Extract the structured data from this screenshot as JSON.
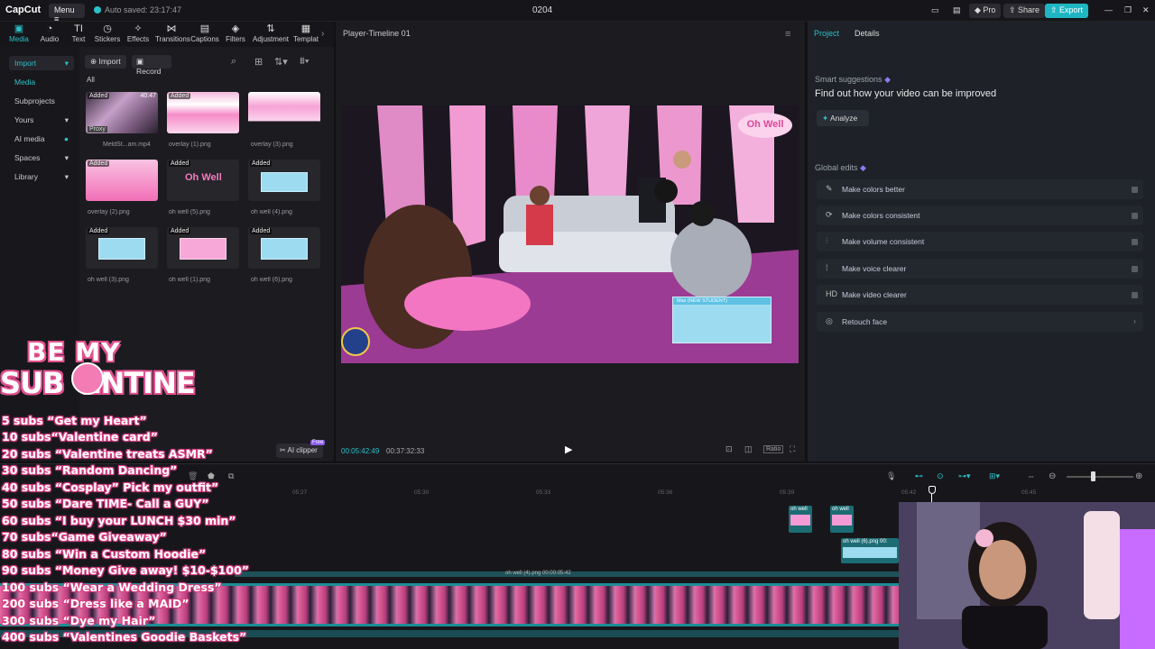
{
  "titlebar": {
    "logo": "CapCut",
    "menu": "Menu",
    "autosave": "Auto saved: 23:17:47",
    "project_name": "0204",
    "pro": "Pro",
    "share": "Share",
    "export": "Export"
  },
  "tools": [
    {
      "label": "Media",
      "icon": "▣"
    },
    {
      "label": "Audio",
      "icon": "◔"
    },
    {
      "label": "Text",
      "icon": "TI"
    },
    {
      "label": "Stickers",
      "icon": "◷"
    },
    {
      "label": "Effects",
      "icon": "✧"
    },
    {
      "label": "Transitions",
      "icon": "⋈"
    },
    {
      "label": "Captions",
      "icon": "▤"
    },
    {
      "label": "Filters",
      "icon": "◈"
    },
    {
      "label": "Adjustment",
      "icon": "⇅"
    },
    {
      "label": "Templat",
      "icon": "▦"
    }
  ],
  "sidebar": {
    "import": "Import",
    "items": [
      "Media",
      "Subprojects",
      "Yours",
      "AI media",
      "Spaces",
      "Library"
    ]
  },
  "media": {
    "import_btn": "Import",
    "record_btn": "Record",
    "filter_all": "All",
    "added_badge": "Added",
    "proxy_badge": "Proxy",
    "duration": "40:47",
    "items": [
      {
        "name": "MeldSt...am.mp4"
      },
      {
        "name": "overlay (1).png"
      },
      {
        "name": "overlay (3).png"
      },
      {
        "name": "overlay (2).png"
      },
      {
        "name": "oh well (5).png"
      },
      {
        "name": "oh well (4).png"
      },
      {
        "name": "oh well (3).png"
      },
      {
        "name": "oh well (1).png"
      },
      {
        "name": "oh well (6).png"
      }
    ],
    "ai_clipper": "AI clipper",
    "free_badge": "Free"
  },
  "player": {
    "title": "Player-Timeline 01",
    "current_time": "00:05:42:49",
    "total_time": "00:37:32:33",
    "ratio": "Ratio",
    "overlay_logo": "Oh Well",
    "popup_title": "Max (NEW STUDENT)"
  },
  "right_panel": {
    "tab_project": "Project",
    "tab_details": "Details",
    "smart_title": "Smart suggestions",
    "smart_sub": "Find out how your video can be improved",
    "analyze": "Analyze",
    "global_title": "Global edits",
    "global_items": [
      {
        "label": "Make colors better",
        "icon": "✎"
      },
      {
        "label": "Make colors consistent",
        "icon": "⟳"
      },
      {
        "label": "Make volume consistent",
        "icon": "⫶"
      },
      {
        "label": "Make voice clearer",
        "icon": "⁞"
      },
      {
        "label": "Make video clearer",
        "icon": "HD"
      },
      {
        "label": "Retouch face",
        "icon": "◎"
      }
    ]
  },
  "timeline": {
    "ruler": [
      "05:27",
      "05:30",
      "05:33",
      "05:36",
      "05:39",
      "05:42",
      "05:45"
    ],
    "clip1": "oh well",
    "clip2": "oh well",
    "clip3": "oh well (6).png   00:",
    "clip4": "oh well (4).png   00:00:05:42"
  },
  "stream_overlay": {
    "banner_top": "BE MY",
    "banner_bottom": "SUB  ENTINE",
    "goals": [
      "5 subs “Get my Heart”",
      "10 subs“Valentine card”",
      "20 subs “Valentine treats ASMR”",
      "30 subs “Random Dancing”",
      "40 subs “Cosplay” Pick my outfit”",
      "50 subs “Dare TIME- Call a GUY”",
      "60 subs “I buy your LUNCH $30 min”",
      "70 subs“Game Giveaway”",
      "80 subs “Win a Custom Hoodie”",
      "90 subs “Money Give away! $10-$100”",
      "100 subs “Wear a Wedding Dress”",
      "200 subs “Dress like a MAID”",
      "300 subs “Dye my Hair”",
      "400 subs “Valentines Goodie Baskets”"
    ]
  }
}
